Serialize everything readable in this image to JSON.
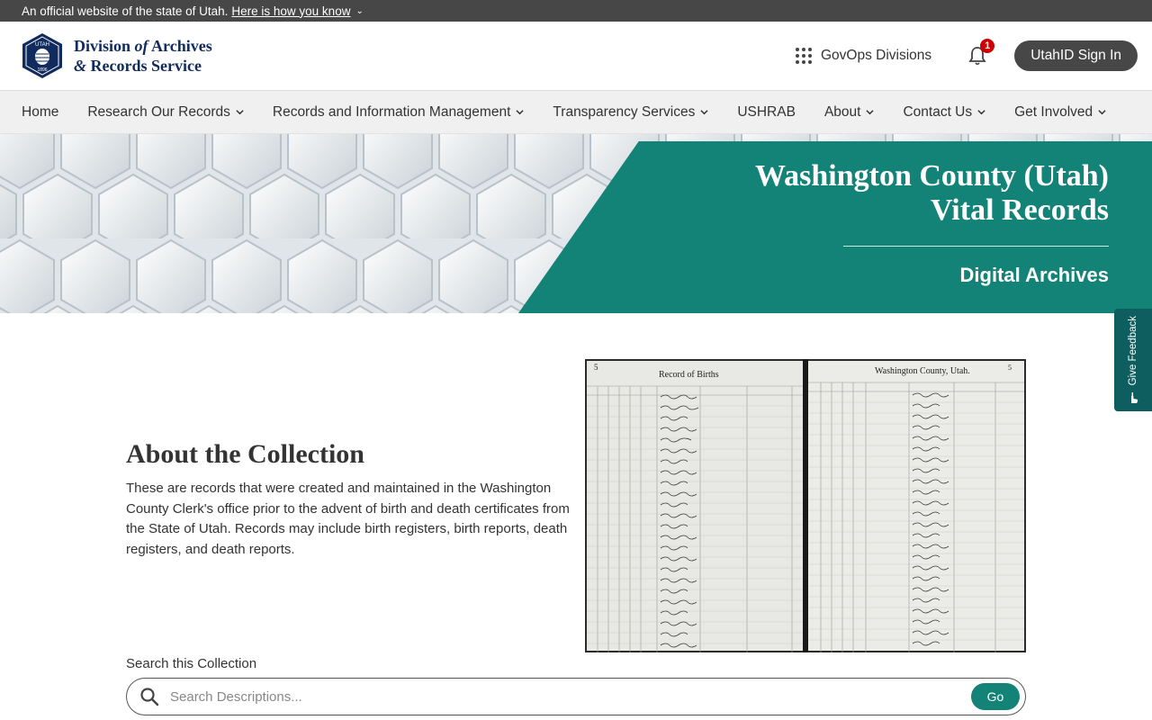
{
  "gov_banner": {
    "text": "An official website of the state of Utah.",
    "link": "Here is how you know"
  },
  "brand": {
    "seal_top": "UTAH",
    "seal_year": "1896",
    "line1": "Division",
    "line1_of": "of",
    "line1_end": "Archives",
    "line2_amp": "&",
    "line2": "Records Service"
  },
  "header": {
    "govops": "GovOps Divisions",
    "notification_count": "1",
    "signin": "UtahID Sign In"
  },
  "nav": {
    "items": [
      {
        "label": "Home",
        "dropdown": false
      },
      {
        "label": "Research Our Records",
        "dropdown": true
      },
      {
        "label": "Records and Information Management",
        "dropdown": true
      },
      {
        "label": "Transparency Services",
        "dropdown": true
      },
      {
        "label": "USHRAB",
        "dropdown": false
      },
      {
        "label": "About",
        "dropdown": true
      },
      {
        "label": "Contact Us",
        "dropdown": true
      },
      {
        "label": "Get Involved",
        "dropdown": true
      }
    ]
  },
  "hero": {
    "title_line1": "Washington County (Utah)",
    "title_line2": "Vital Records",
    "subtitle": "Digital Archives"
  },
  "feedback": {
    "label": "Give Feedback"
  },
  "about": {
    "heading": "About the Collection",
    "body": "These are records that were created and maintained in the Washington County Clerk's office prior to the advent of birth and death certificates from the State of Utah. Records may include birth registers, birth reports, death registers, and death reports."
  },
  "ledger": {
    "left_header": "Record of Births",
    "right_header": "Washington County, Utah.",
    "page_left": "5",
    "page_right": "5"
  },
  "search": {
    "label": "Search this Collection",
    "placeholder": "Search Descriptions...",
    "value": "",
    "button": "Go"
  },
  "colors": {
    "brand_navy": "#122b5e",
    "accent_teal": "#148377",
    "banner_gray": "#474747"
  }
}
